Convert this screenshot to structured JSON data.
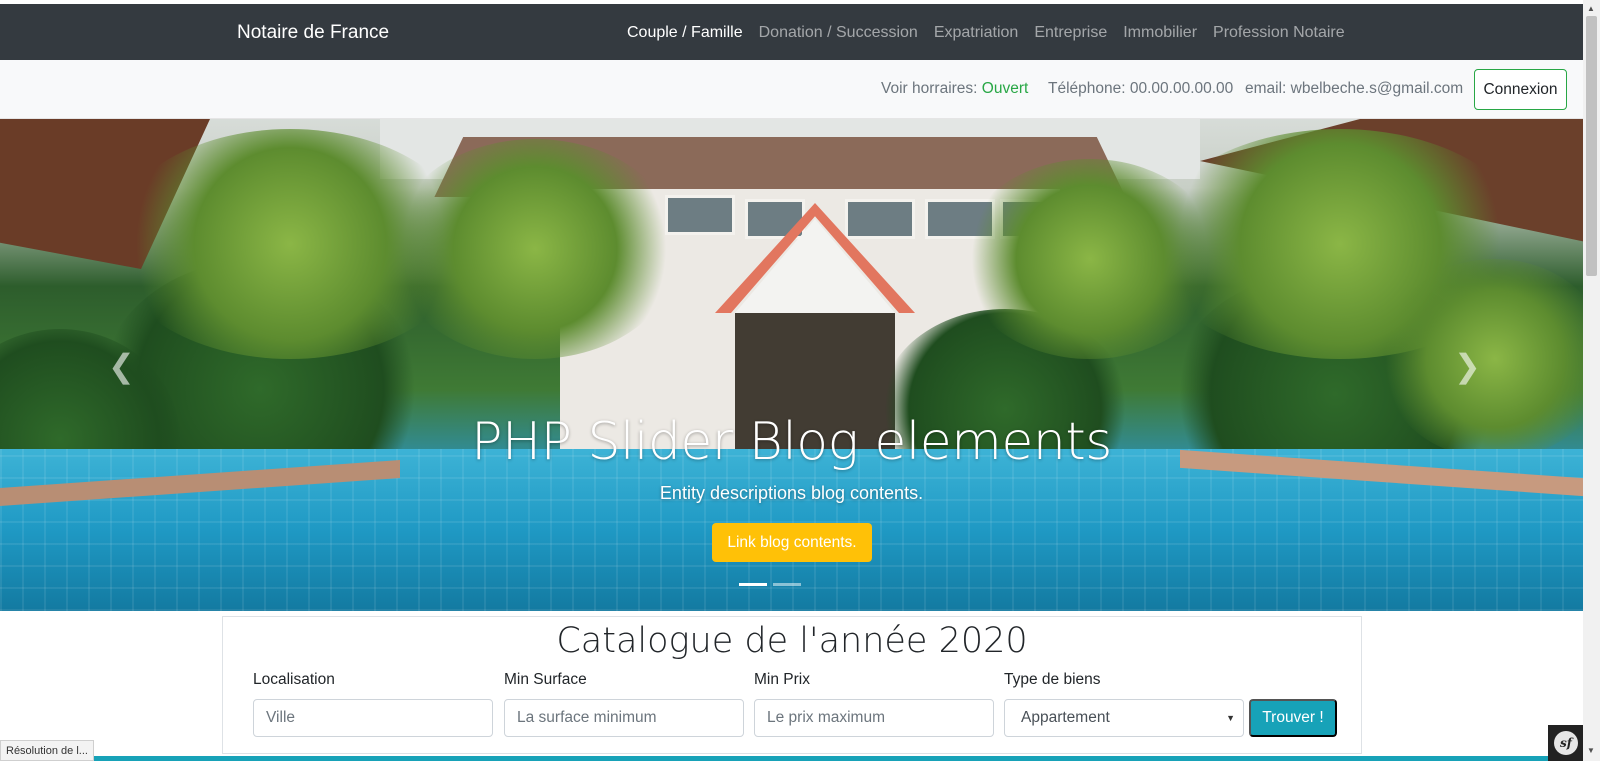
{
  "navbar": {
    "brand": "Notaire de France",
    "items": [
      {
        "label": "Couple / Famille",
        "active": true
      },
      {
        "label": "Donation / Succession",
        "active": false
      },
      {
        "label": "Expatriation",
        "active": false
      },
      {
        "label": "Entreprise",
        "active": false
      },
      {
        "label": "Immobilier",
        "active": false
      },
      {
        "label": "Profession Notaire",
        "active": false
      }
    ]
  },
  "infobar": {
    "hours_label": "Voir horraires:",
    "hours_status": "Ouvert",
    "phone": "Téléphone: 00.00.00.00.00",
    "email": "email: wbelbeche.s@gmail.com",
    "login_button": "Connexion"
  },
  "slider": {
    "title": "PHP Slider Blog elements",
    "subtitle": "Entity descriptions blog contents.",
    "button": "Link blog contents.",
    "prev_icon": "chevron-left-icon",
    "next_icon": "chevron-right-icon"
  },
  "catalogue": {
    "title": "Catalogue de l'année 2020",
    "fields": [
      {
        "label": "Localisation",
        "placeholder": "Ville"
      },
      {
        "label": "Min Surface",
        "placeholder": "La surface minimum"
      },
      {
        "label": "Min Prix",
        "placeholder": "Le prix maximum"
      },
      {
        "label": "Type de biens",
        "selected": "Appartement"
      }
    ],
    "submit": "Trouver !"
  },
  "status_bar": "Résolution de l...",
  "colors": {
    "navbar": "#343a40",
    "open_status": "#28a745",
    "blog_button": "#ffc107",
    "find_button": "#17a2b8"
  }
}
